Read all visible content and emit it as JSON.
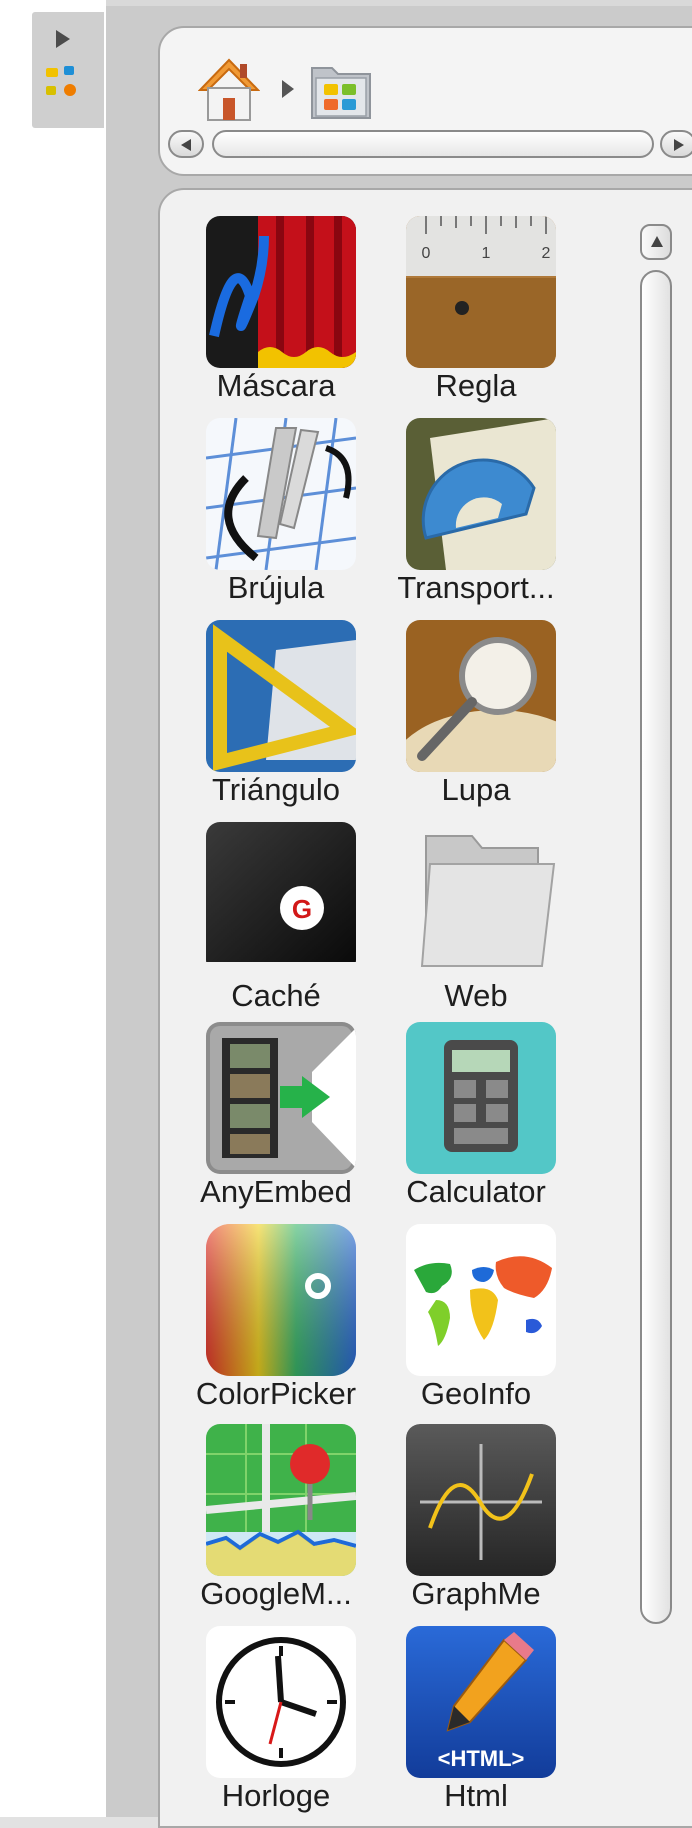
{
  "side_tab": {
    "toggle_icon": "play-arrow-icon",
    "widget_icon": "toolbox-icon"
  },
  "breadcrumb": {
    "home_icon": "home-icon",
    "folder_icon": "library-folder-icon",
    "separator_icon": "chevron-right-icon"
  },
  "scrollbars": {
    "left_icon": "scroll-left-icon",
    "right_icon": "scroll-right-icon",
    "up_icon": "scroll-up-icon"
  },
  "tools": [
    {
      "label": "Máscara",
      "icon": "mask-curtain-icon"
    },
    {
      "label": "Regla",
      "icon": "ruler-icon"
    },
    {
      "label": "Brújula",
      "icon": "compass-icon"
    },
    {
      "label": "Transport...",
      "icon": "protractor-icon"
    },
    {
      "label": "Triángulo",
      "icon": "set-square-icon"
    },
    {
      "label": "Lupa",
      "icon": "magnifier-icon"
    },
    {
      "label": "Caché",
      "icon": "cache-icon"
    },
    {
      "label": "Web",
      "icon": "folder-icon"
    },
    {
      "label": "AnyEmbed",
      "icon": "film-embed-icon"
    },
    {
      "label": "Calculator",
      "icon": "calculator-icon"
    },
    {
      "label": "ColorPicker",
      "icon": "color-picker-icon"
    },
    {
      "label": "GeoInfo",
      "icon": "world-map-icon"
    },
    {
      "label": "GoogleM...",
      "icon": "map-pin-icon"
    },
    {
      "label": "GraphMe",
      "icon": "sine-graph-icon"
    },
    {
      "label": "Horloge",
      "icon": "clock-icon"
    },
    {
      "label": "Html",
      "icon": "html-pencil-icon"
    }
  ],
  "html_badge_text": "<HTML>",
  "colors": {
    "frame": "#cbcbcb",
    "panel": "#f1f1f1",
    "border": "#a8a8a8"
  }
}
